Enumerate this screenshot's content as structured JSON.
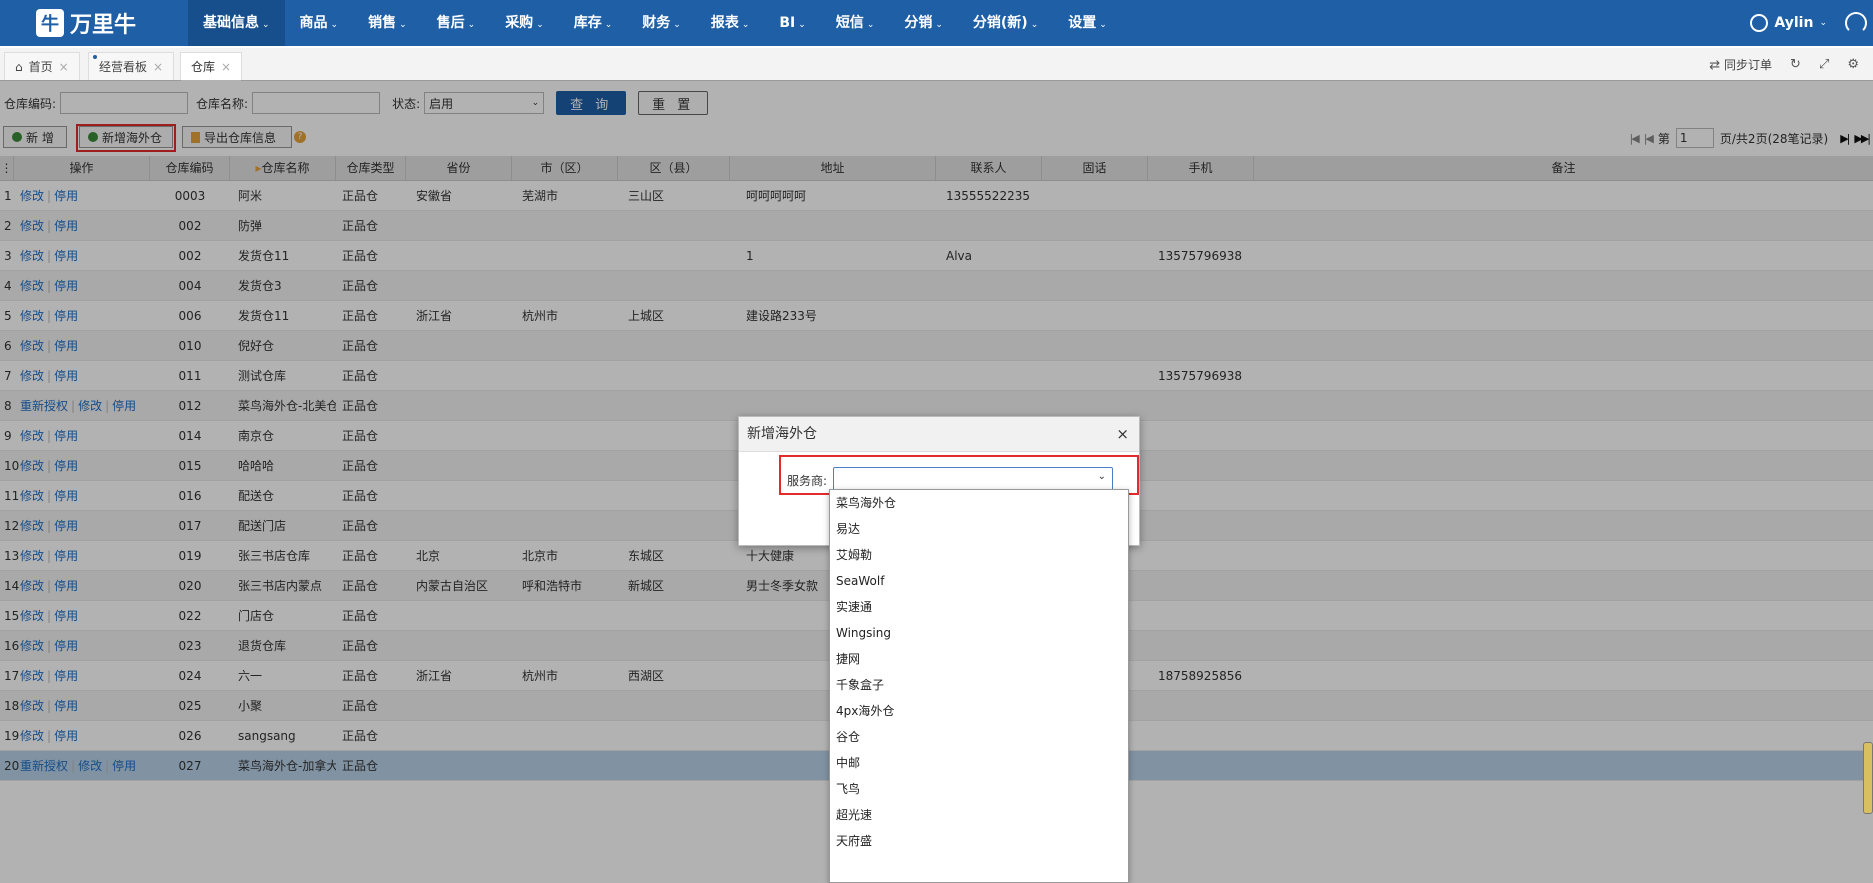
{
  "app": {
    "logo_text": "万里牛"
  },
  "nav": {
    "items": [
      {
        "label": "基础信息",
        "active": true
      },
      {
        "label": "商品"
      },
      {
        "label": "销售"
      },
      {
        "label": "售后"
      },
      {
        "label": "采购"
      },
      {
        "label": "库存"
      },
      {
        "label": "财务"
      },
      {
        "label": "报表"
      },
      {
        "label": "BI"
      },
      {
        "label": "短信"
      },
      {
        "label": "分销"
      },
      {
        "label": "分销(新)"
      },
      {
        "label": "设置"
      }
    ],
    "user_name": "Aylin"
  },
  "tabs": [
    {
      "label": "首页"
    },
    {
      "label": "经营看板"
    },
    {
      "label": "仓库",
      "active": true
    }
  ],
  "tabbar_right": {
    "sync_label": "同步订单"
  },
  "filters": {
    "code_label": "仓库编码:",
    "name_label": "仓库名称:",
    "status_label": "状态:",
    "status_value": "启用",
    "query_label": "查 询",
    "reset_label": "重 置"
  },
  "toolbar": {
    "add_label": "新 增",
    "add_overseas_label": "新增海外仓",
    "export_label": "导出仓库信息",
    "help": "?"
  },
  "pager": {
    "page_prefix": "第",
    "current_page": "1",
    "page_suffix": "页/共2页(28笔记录)"
  },
  "table": {
    "headers": [
      "操作",
      "仓库编码",
      "仓库名称",
      "仓库类型",
      "省份",
      "市（区）",
      "区（县）",
      "地址",
      "联系人",
      "固话",
      "手机",
      "备注"
    ],
    "rows": [
      {
        "no": "1",
        "ops": [
          "修改",
          "停用"
        ],
        "code": "0003",
        "name": "阿米",
        "type": "正品仓",
        "province": "安徽省",
        "city": "芜湖市",
        "district": "三山区",
        "address": "呵呵呵呵呵",
        "contact": "13555522235",
        "phone": "",
        "mobile": ""
      },
      {
        "no": "2",
        "ops": [
          "修改",
          "停用"
        ],
        "code": "002",
        "name": "防弹",
        "type": "正品仓",
        "province": "",
        "city": "",
        "district": "",
        "address": "",
        "contact": "",
        "phone": "",
        "mobile": ""
      },
      {
        "no": "3",
        "ops": [
          "修改",
          "停用"
        ],
        "code": "002",
        "name": "发货仓11",
        "type": "正品仓",
        "province": "",
        "city": "",
        "district": "",
        "address": "1",
        "contact": "Alva",
        "phone": "",
        "mobile": "13575796938"
      },
      {
        "no": "4",
        "ops": [
          "修改",
          "停用"
        ],
        "code": "004",
        "name": "发货仓3",
        "type": "正品仓",
        "province": "",
        "city": "",
        "district": "",
        "address": "",
        "contact": "",
        "phone": "",
        "mobile": ""
      },
      {
        "no": "5",
        "ops": [
          "修改",
          "停用"
        ],
        "code": "006",
        "name": "发货仓11",
        "type": "正品仓",
        "province": "浙江省",
        "city": "杭州市",
        "district": "上城区",
        "address": "建设路233号",
        "contact": "",
        "phone": "",
        "mobile": ""
      },
      {
        "no": "6",
        "ops": [
          "修改",
          "停用"
        ],
        "code": "010",
        "name": "倪好仓",
        "type": "正品仓",
        "province": "",
        "city": "",
        "district": "",
        "address": "",
        "contact": "",
        "phone": "",
        "mobile": ""
      },
      {
        "no": "7",
        "ops": [
          "修改",
          "停用"
        ],
        "code": "011",
        "name": "测试仓库",
        "type": "正品仓",
        "province": "",
        "city": "",
        "district": "",
        "address": "",
        "contact": "",
        "phone": "",
        "mobile": "13575796938"
      },
      {
        "no": "8",
        "ops": [
          "重新授权",
          "修改",
          "停用"
        ],
        "code": "012",
        "name": "菜鸟海外仓-北美仓",
        "type": "正品仓",
        "province": "",
        "city": "",
        "district": "",
        "address": "",
        "contact": "",
        "phone": "",
        "mobile": ""
      },
      {
        "no": "9",
        "ops": [
          "修改",
          "停用"
        ],
        "code": "014",
        "name": "南京仓",
        "type": "正品仓",
        "province": "",
        "city": "",
        "district": "",
        "address": "",
        "contact": "",
        "phone": "",
        "mobile": ""
      },
      {
        "no": "10",
        "ops": [
          "修改",
          "停用"
        ],
        "code": "015",
        "name": "哈哈哈",
        "type": "正品仓",
        "province": "",
        "city": "",
        "district": "",
        "address": "",
        "contact": "",
        "phone": "",
        "mobile": ""
      },
      {
        "no": "11",
        "ops": [
          "修改",
          "停用"
        ],
        "code": "016",
        "name": "配送仓",
        "type": "正品仓",
        "province": "",
        "city": "",
        "district": "",
        "address": "",
        "contact": "",
        "phone": "",
        "mobile": ""
      },
      {
        "no": "12",
        "ops": [
          "修改",
          "停用"
        ],
        "code": "017",
        "name": "配送门店",
        "type": "正品仓",
        "province": "",
        "city": "",
        "district": "",
        "address": "",
        "contact": "",
        "phone": "",
        "mobile": ""
      },
      {
        "no": "13",
        "ops": [
          "修改",
          "停用"
        ],
        "code": "019",
        "name": "张三书店仓库",
        "type": "正品仓",
        "province": "北京",
        "city": "北京市",
        "district": "东城区",
        "address": "十大健康",
        "contact": "",
        "phone": "",
        "mobile": ""
      },
      {
        "no": "14",
        "ops": [
          "修改",
          "停用"
        ],
        "code": "020",
        "name": "张三书店内蒙点",
        "type": "正品仓",
        "province": "内蒙古自治区",
        "city": "呼和浩特市",
        "district": "新城区",
        "address": "男士冬季女款",
        "contact": "",
        "phone": "",
        "mobile": ""
      },
      {
        "no": "15",
        "ops": [
          "修改",
          "停用"
        ],
        "code": "022",
        "name": "门店仓",
        "type": "正品仓",
        "province": "",
        "city": "",
        "district": "",
        "address": "",
        "contact": "",
        "phone": "",
        "mobile": ""
      },
      {
        "no": "16",
        "ops": [
          "修改",
          "停用"
        ],
        "code": "023",
        "name": "退货仓库",
        "type": "正品仓",
        "province": "",
        "city": "",
        "district": "",
        "address": "",
        "contact": "",
        "phone": "",
        "mobile": ""
      },
      {
        "no": "17",
        "ops": [
          "修改",
          "停用"
        ],
        "code": "024",
        "name": "六一",
        "type": "正品仓",
        "province": "浙江省",
        "city": "杭州市",
        "district": "西湖区",
        "address": "",
        "contact": "",
        "phone": "",
        "mobile": "18758925856"
      },
      {
        "no": "18",
        "ops": [
          "修改",
          "停用"
        ],
        "code": "025",
        "name": "小聚",
        "type": "正品仓",
        "province": "",
        "city": "",
        "district": "",
        "address": "",
        "contact": "",
        "phone": "",
        "mobile": ""
      },
      {
        "no": "19",
        "ops": [
          "修改",
          "停用"
        ],
        "code": "026",
        "name": "sangsang",
        "type": "正品仓",
        "province": "",
        "city": "",
        "district": "",
        "address": "",
        "contact": "",
        "phone": "",
        "mobile": ""
      },
      {
        "no": "20",
        "ops": [
          "重新授权",
          "修改",
          "停用"
        ],
        "code": "027",
        "name": "菜鸟海外仓-加拿大",
        "type": "正品仓",
        "province": "",
        "city": "",
        "district": "",
        "address": "",
        "contact": "",
        "phone": "",
        "mobile": "",
        "selected": true
      }
    ]
  },
  "dialog": {
    "title": "新增海外仓",
    "close": "×",
    "provider_label": "服务商:",
    "provider_value": ""
  },
  "dropdown": {
    "options": [
      "菜鸟海外仓",
      "易达",
      "艾姆勒",
      "SeaWolf",
      "实速通",
      "Wingsing",
      "捷网",
      "千象盒子",
      "4px海外仓",
      "谷仓",
      "中邮",
      "飞鸟",
      "超光速",
      "天府盛"
    ]
  },
  "colors": {
    "brand": "#1f5fa6",
    "link": "#1f6fc4",
    "highlight": "#e32b2b"
  }
}
